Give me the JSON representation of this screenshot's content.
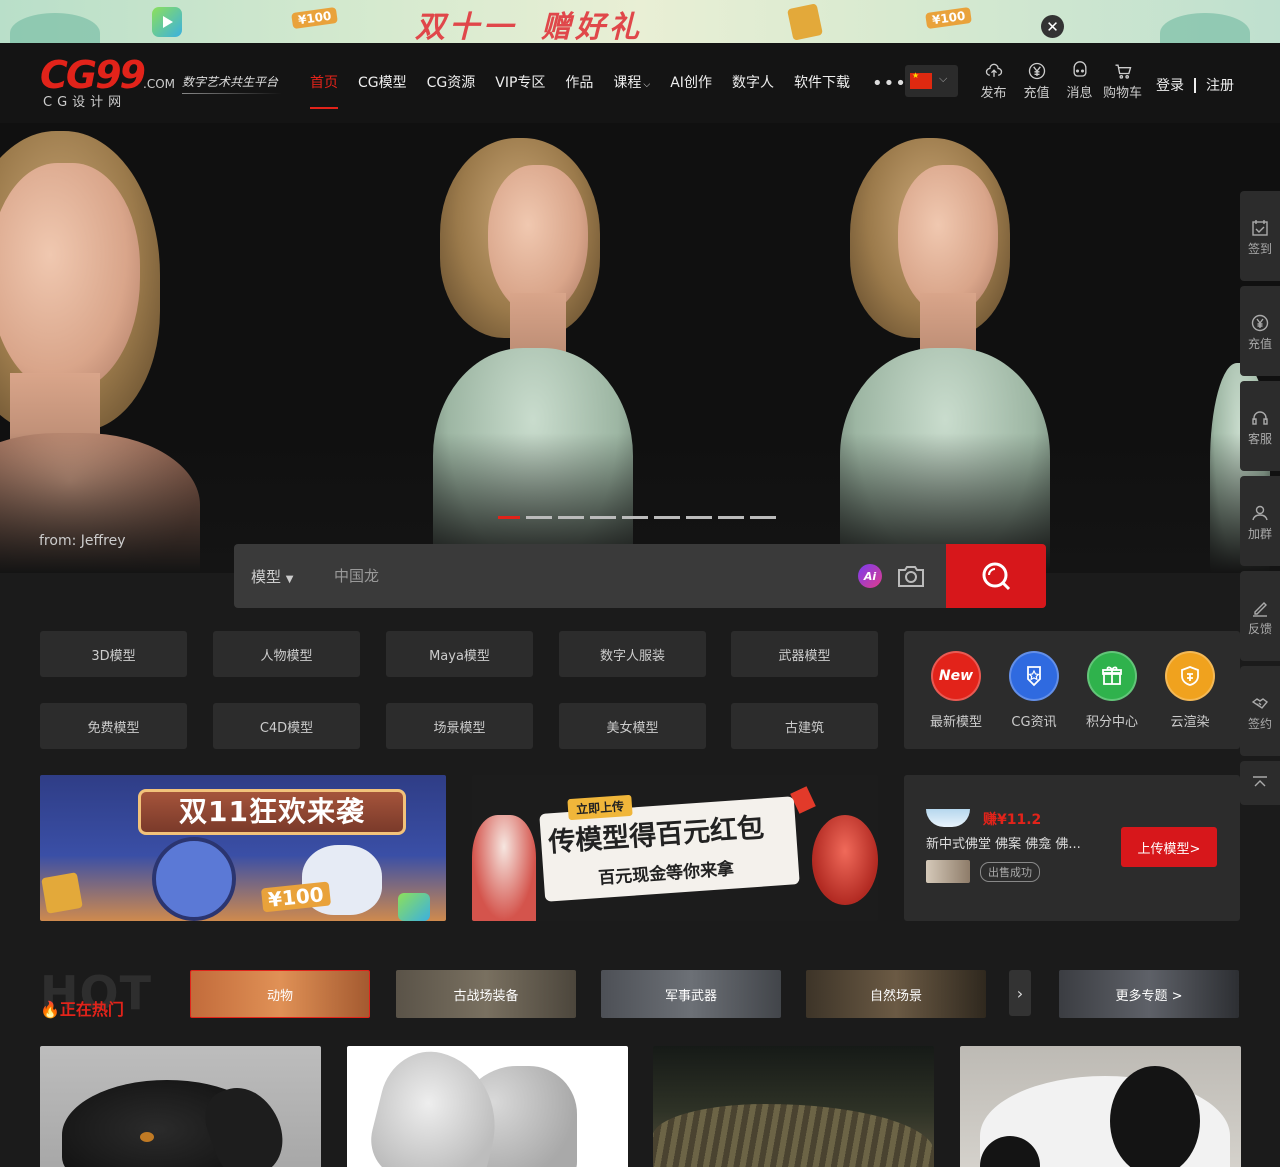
{
  "promo": {
    "title_part1": "双十一",
    "title_part2": "赠好礼",
    "badge_100": "¥100",
    "close_label": "✕"
  },
  "header": {
    "logo_text": "CG99",
    "logo_com": ".COM",
    "logo_sub": "CG设计网",
    "slogan": "数字艺术共生平台",
    "nav": [
      {
        "label": "首页",
        "active": true
      },
      {
        "label": "CG模型"
      },
      {
        "label": "CG资源"
      },
      {
        "label": "VIP专区"
      },
      {
        "label": "作品"
      },
      {
        "label": "课程"
      },
      {
        "label": "AI创作"
      },
      {
        "label": "数字人"
      },
      {
        "label": "软件下载"
      }
    ],
    "more": "•••",
    "language": "中文",
    "actions": [
      {
        "label": "发布",
        "icon": "upload-cloud-icon"
      },
      {
        "label": "充值",
        "icon": "yen-circle-icon"
      },
      {
        "label": "消息",
        "icon": "message-icon"
      },
      {
        "label": "购物车",
        "icon": "cart-icon"
      }
    ],
    "login": "登录",
    "register": "注册"
  },
  "hero": {
    "credit": "from: Jeffrey",
    "slide_count": 9,
    "active_slide": 1
  },
  "search": {
    "type": "模型",
    "placeholder": "中国龙",
    "ai_label": "Ai"
  },
  "tags": [
    "3D模型",
    "人物模型",
    "Maya模型",
    "数字人服装",
    "武器模型",
    "免费模型",
    "C4D模型",
    "场景模型",
    "美女模型",
    "古建筑"
  ],
  "quick_links": [
    {
      "label": "最新模型",
      "icon": "new-badge-icon",
      "color": "#e2231a",
      "badge": "New"
    },
    {
      "label": "CG资讯",
      "icon": "star-shield-icon",
      "color": "#2f6ae0"
    },
    {
      "label": "积分中心",
      "icon": "gift-icon",
      "color": "#2fb24c"
    },
    {
      "label": "云渲染",
      "icon": "cloud-render-icon",
      "color": "#f0a21e"
    }
  ],
  "banners": {
    "left_title": "双11狂欢来袭",
    "left_badge": "¥100",
    "right_upload": "立即上传",
    "right_title": "传模型得百元红包",
    "right_sub": "百元现金等你来拿"
  },
  "income": {
    "earn": "赚¥11.2",
    "desc": "新中式佛堂 佛案 佛龛 佛...",
    "badge": "出售成功",
    "upload_button": "上传模型>"
  },
  "hot": {
    "bg_text": "HOT",
    "label": "正在热门",
    "topics": [
      {
        "label": "动物",
        "active": true
      },
      {
        "label": "古战场装备"
      },
      {
        "label": "军事武器"
      },
      {
        "label": "自然场景"
      }
    ],
    "next": "›",
    "more": "更多专题 >"
  },
  "models": [
    {
      "name": "dog"
    },
    {
      "name": "horse"
    },
    {
      "name": "crocodile"
    },
    {
      "name": "panda"
    }
  ],
  "sidebar": [
    {
      "label": "签到",
      "icon": "checkin-icon"
    },
    {
      "label": "充值",
      "icon": "yen-circle-icon"
    },
    {
      "label": "客服",
      "icon": "headset-icon"
    },
    {
      "label": "加群",
      "icon": "group-icon"
    },
    {
      "label": "反馈",
      "icon": "pen-icon"
    },
    {
      "label": "签约",
      "icon": "handshake-icon"
    }
  ],
  "colors": {
    "brand_red": "#e2231a",
    "search_button": "#d7171b",
    "page_bg": "#1b1b1b",
    "card_bg": "#2c2c2c"
  }
}
